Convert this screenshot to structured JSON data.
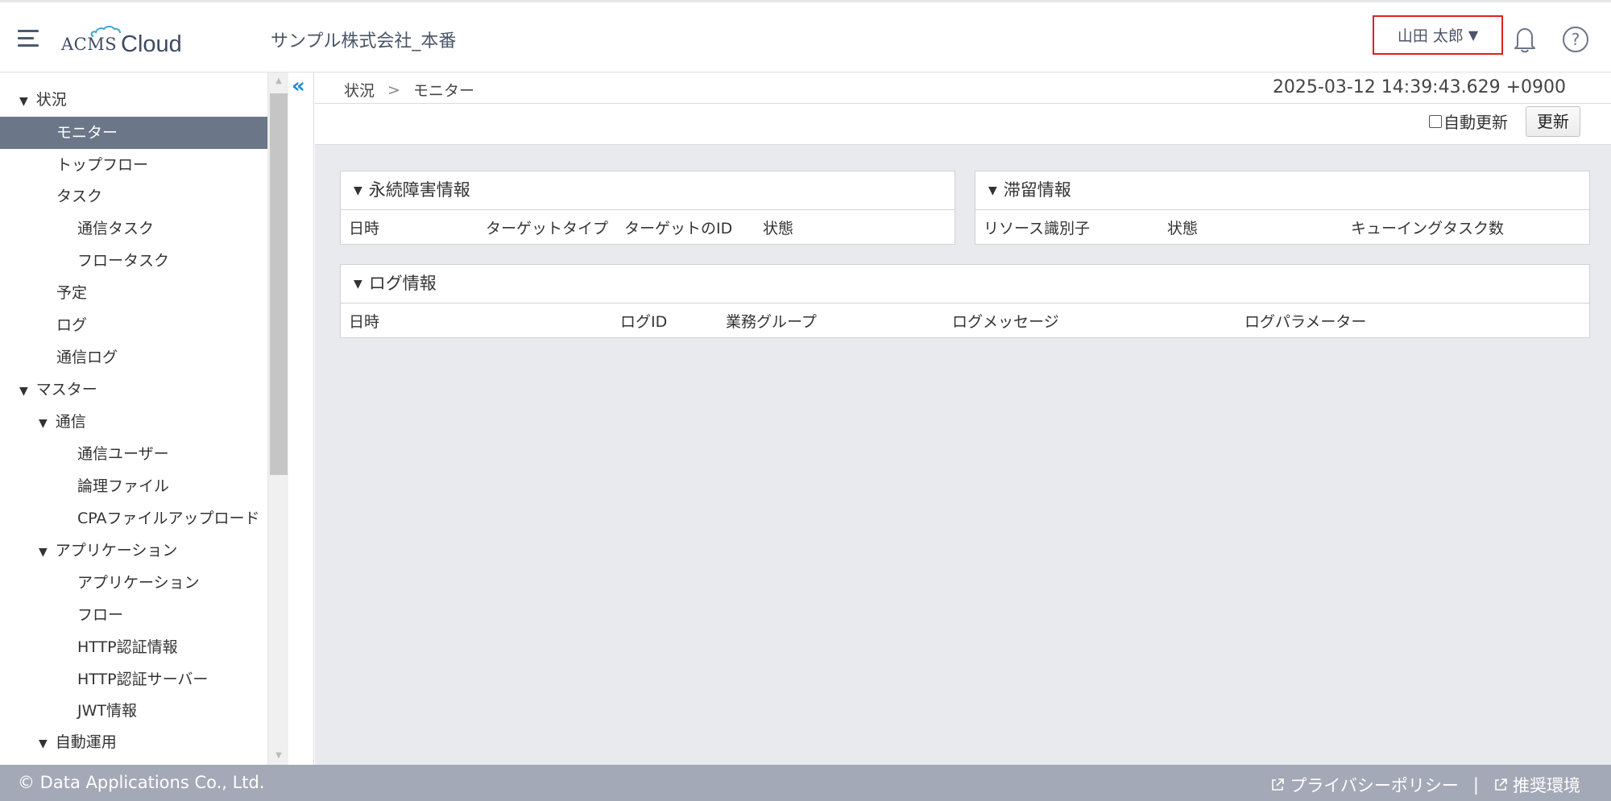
{
  "header": {
    "logo_prefix": "ACMS",
    "logo_word": "Cloud",
    "company": "サンプル株式会社_本番",
    "user_name": "山田 太郎",
    "user_caret": "▼",
    "help_glyph": "?"
  },
  "sidebar": {
    "tri": "▼",
    "items": [
      {
        "label": "状況"
      },
      {
        "label": "モニター"
      },
      {
        "label": "トップフロー"
      },
      {
        "label": "タスク"
      },
      {
        "label": "通信タスク"
      },
      {
        "label": "フロータスク"
      },
      {
        "label": "予定"
      },
      {
        "label": "ログ"
      },
      {
        "label": "通信ログ"
      },
      {
        "label": "マスター"
      },
      {
        "label": "通信"
      },
      {
        "label": "通信ユーザー"
      },
      {
        "label": "論理ファイル"
      },
      {
        "label": "CPAファイルアップロード"
      },
      {
        "label": "アプリケーション"
      },
      {
        "label": "アプリケーション"
      },
      {
        "label": "フロー"
      },
      {
        "label": "HTTP認証情報"
      },
      {
        "label": "HTTP認証サーバー"
      },
      {
        "label": "JWT情報"
      },
      {
        "label": "自動運用"
      }
    ],
    "collapse_glyph": "«"
  },
  "main": {
    "breadcrumb": {
      "root": "状況",
      "sep": ">",
      "current": "モニター"
    },
    "timestamp": "2025-03-12 14:39:43.629 +0900",
    "auto_refresh_label": "自動更新",
    "refresh_button": "更新",
    "panels": {
      "persistent_failure": {
        "title": "永続障害情報",
        "columns": [
          "日時",
          "ターゲットタイプ",
          "ターゲットのID",
          "状態"
        ]
      },
      "stagnation": {
        "title": "滞留情報",
        "columns": [
          "リソース識別子",
          "状態",
          "キューイングタスク数"
        ]
      },
      "log": {
        "title": "ログ情報",
        "columns": [
          "日時",
          "ログID",
          "業務グループ",
          "ログメッセージ",
          "ログパラメーター"
        ]
      }
    }
  },
  "footer": {
    "copyright": "© Data Applications Co., Ltd.",
    "privacy": "プライバシーポリシー",
    "divider": "|",
    "recommended": "推奨環境"
  },
  "colors": {
    "active_nav_bg": "#6b7689",
    "main_bg": "#e9eaee",
    "footer_bg": "#a3a9b6",
    "accent_blue": "#1f8bd1",
    "user_menu_border": "#e02020"
  }
}
